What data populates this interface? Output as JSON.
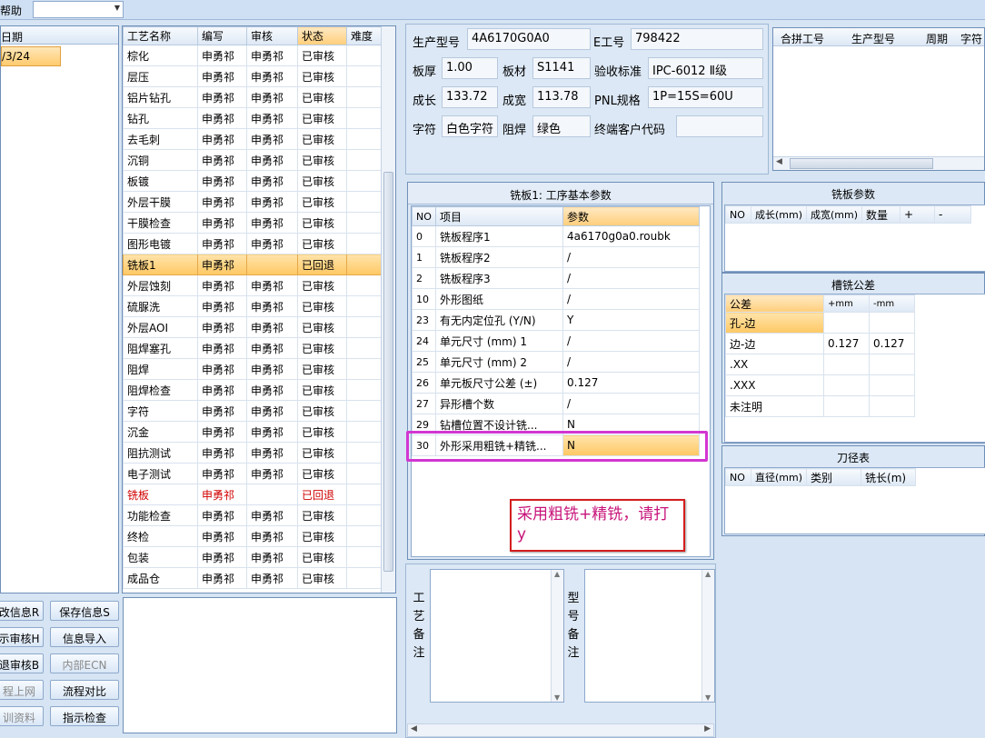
{
  "topbar": {
    "menu_label": "帮助"
  },
  "date_panel": {
    "header": "日期",
    "selected_value": "/3/24"
  },
  "process_grid": {
    "columns": [
      "工艺名称",
      "编写",
      "审核",
      "状态",
      "难度"
    ],
    "rows": [
      {
        "name": "棕化",
        "writer": "申勇祁",
        "reviewer": "申勇祁",
        "status": "已审核"
      },
      {
        "name": "层压",
        "writer": "申勇祁",
        "reviewer": "申勇祁",
        "status": "已审核"
      },
      {
        "name": "铝片钻孔",
        "writer": "申勇祁",
        "reviewer": "申勇祁",
        "status": "已审核"
      },
      {
        "name": "钻孔",
        "writer": "申勇祁",
        "reviewer": "申勇祁",
        "status": "已审核"
      },
      {
        "name": "去毛刺",
        "writer": "申勇祁",
        "reviewer": "申勇祁",
        "status": "已审核"
      },
      {
        "name": "沉铜",
        "writer": "申勇祁",
        "reviewer": "申勇祁",
        "status": "已审核"
      },
      {
        "name": "板镀",
        "writer": "申勇祁",
        "reviewer": "申勇祁",
        "status": "已审核"
      },
      {
        "name": "外层干膜",
        "writer": "申勇祁",
        "reviewer": "申勇祁",
        "status": "已审核"
      },
      {
        "name": "干膜检查",
        "writer": "申勇祁",
        "reviewer": "申勇祁",
        "status": "已审核"
      },
      {
        "name": "图形电镀",
        "writer": "申勇祁",
        "reviewer": "申勇祁",
        "status": "已审核"
      },
      {
        "name": "铣板1",
        "writer": "申勇祁",
        "reviewer": "",
        "status": "已回退"
      },
      {
        "name": "外层蚀刻",
        "writer": "申勇祁",
        "reviewer": "申勇祁",
        "status": "已审核"
      },
      {
        "name": "硫脲洗",
        "writer": "申勇祁",
        "reviewer": "申勇祁",
        "status": "已审核"
      },
      {
        "name": "外层AOI",
        "writer": "申勇祁",
        "reviewer": "申勇祁",
        "status": "已审核"
      },
      {
        "name": "阻焊塞孔",
        "writer": "申勇祁",
        "reviewer": "申勇祁",
        "status": "已审核"
      },
      {
        "name": "阻焊",
        "writer": "申勇祁",
        "reviewer": "申勇祁",
        "status": "已审核"
      },
      {
        "name": "阻焊检查",
        "writer": "申勇祁",
        "reviewer": "申勇祁",
        "status": "已审核"
      },
      {
        "name": "字符",
        "writer": "申勇祁",
        "reviewer": "申勇祁",
        "status": "已审核"
      },
      {
        "name": "沉金",
        "writer": "申勇祁",
        "reviewer": "申勇祁",
        "status": "已审核"
      },
      {
        "name": "阻抗测试",
        "writer": "申勇祁",
        "reviewer": "申勇祁",
        "status": "已审核"
      },
      {
        "name": "电子测试",
        "writer": "申勇祁",
        "reviewer": "申勇祁",
        "status": "已审核"
      },
      {
        "name": "铣板",
        "writer": "申勇祁",
        "reviewer": "",
        "status": "已回退"
      },
      {
        "name": "功能检查",
        "writer": "申勇祁",
        "reviewer": "申勇祁",
        "status": "已审核"
      },
      {
        "name": "终检",
        "writer": "申勇祁",
        "reviewer": "申勇祁",
        "status": "已审核"
      },
      {
        "name": "包装",
        "writer": "申勇祁",
        "reviewer": "申勇祁",
        "status": "已审核"
      },
      {
        "name": "成品仓",
        "writer": "申勇祁",
        "reviewer": "申勇祁",
        "status": "已审核"
      }
    ]
  },
  "left_buttons": [
    {
      "label": "改信息R"
    },
    {
      "label": "保存信息S"
    },
    {
      "label": "示审核H"
    },
    {
      "label": "信息导入"
    },
    {
      "label": "退审核B"
    },
    {
      "label": "内部ECN"
    },
    {
      "label": "程上网"
    },
    {
      "label": "流程对比"
    },
    {
      "label": "训资料"
    },
    {
      "label": "指示检查"
    }
  ],
  "product_info": {
    "model_label": "生产型号",
    "model_value": "4A6170G0A0",
    "eno_label": "E工号",
    "eno_value": "798422",
    "thickness_label": "板厚",
    "thickness_value": "1.00",
    "material_label": "板材",
    "material_value": "S1141",
    "standard_label": "验收标准",
    "standard_value": "IPC-6012 Ⅱ级",
    "length_label": "成长",
    "length_value": "133.72",
    "width_label": "成宽",
    "width_value": "113.78",
    "pnl_label": "PNL规格",
    "pnl_value": "1P=15S=60U",
    "char_label": "字符",
    "char_value": "白色字符",
    "mask_label": "阻焊",
    "mask_value": "绿色",
    "customer_label": "终端客户代码",
    "customer_value": ""
  },
  "merge_grid": {
    "columns": [
      "合拼工号",
      "生产型号",
      "周期",
      "字符"
    ]
  },
  "param_panel": {
    "title": "铣板1: 工序基本参数",
    "columns": [
      "NO",
      "项目",
      "参数"
    ],
    "rows": [
      {
        "no": "0",
        "item": "铣板程序1",
        "value": "4a6170g0a0.roubk"
      },
      {
        "no": "1",
        "item": "铣板程序2",
        "value": "/"
      },
      {
        "no": "2",
        "item": "铣板程序3",
        "value": "/"
      },
      {
        "no": "10",
        "item": "外形图纸",
        "value": "/"
      },
      {
        "no": "23",
        "item": "有无内定位孔 (Y/N)",
        "value": "Y"
      },
      {
        "no": "24",
        "item": "单元尺寸 (mm) 1",
        "value": "/"
      },
      {
        "no": "25",
        "item": "单元尺寸 (mm) 2",
        "value": "/"
      },
      {
        "no": "26",
        "item": "单元板尺寸公差 (±)",
        "value": "0.127"
      },
      {
        "no": "27",
        "item": "异形槽个数",
        "value": "/"
      },
      {
        "no": "29",
        "item": "钻槽位置不设计铣...",
        "value": "N"
      },
      {
        "no": "30",
        "item": "外形采用粗铣+精铣...",
        "value": "N"
      }
    ]
  },
  "annotation": {
    "text": "采用粗铣+精铣，请打y"
  },
  "mill_params": {
    "title": "铣板参数",
    "columns": [
      "NO",
      "成长(mm)",
      "成宽(mm)",
      "数量",
      "+",
      "-"
    ]
  },
  "slot_tolerance": {
    "title": "槽铣公差",
    "columns": [
      "公差",
      "+mm",
      "-mm"
    ],
    "rows": [
      {
        "name": "孔-边",
        "plus": "",
        "minus": ""
      },
      {
        "name": "边-边",
        "plus": "0.127",
        "minus": "0.127"
      },
      {
        "name": ".XX",
        "plus": "",
        "minus": ""
      },
      {
        "name": ".XXX",
        "plus": "",
        "minus": ""
      },
      {
        "name": "未注明",
        "plus": "",
        "minus": ""
      }
    ]
  },
  "tool_table": {
    "title": "刀径表",
    "columns": [
      "NO",
      "直径(mm)",
      "类别",
      "铣长(m)"
    ]
  },
  "memo": {
    "process_label": "工艺备注",
    "model_label": "型号备注"
  },
  "colors": {
    "accent_orange": "#ffc864",
    "highlight_magenta": "#d236d2",
    "note_red": "#d41d1d",
    "note_text": "#c8147a",
    "rollback_red": "#d00000"
  }
}
